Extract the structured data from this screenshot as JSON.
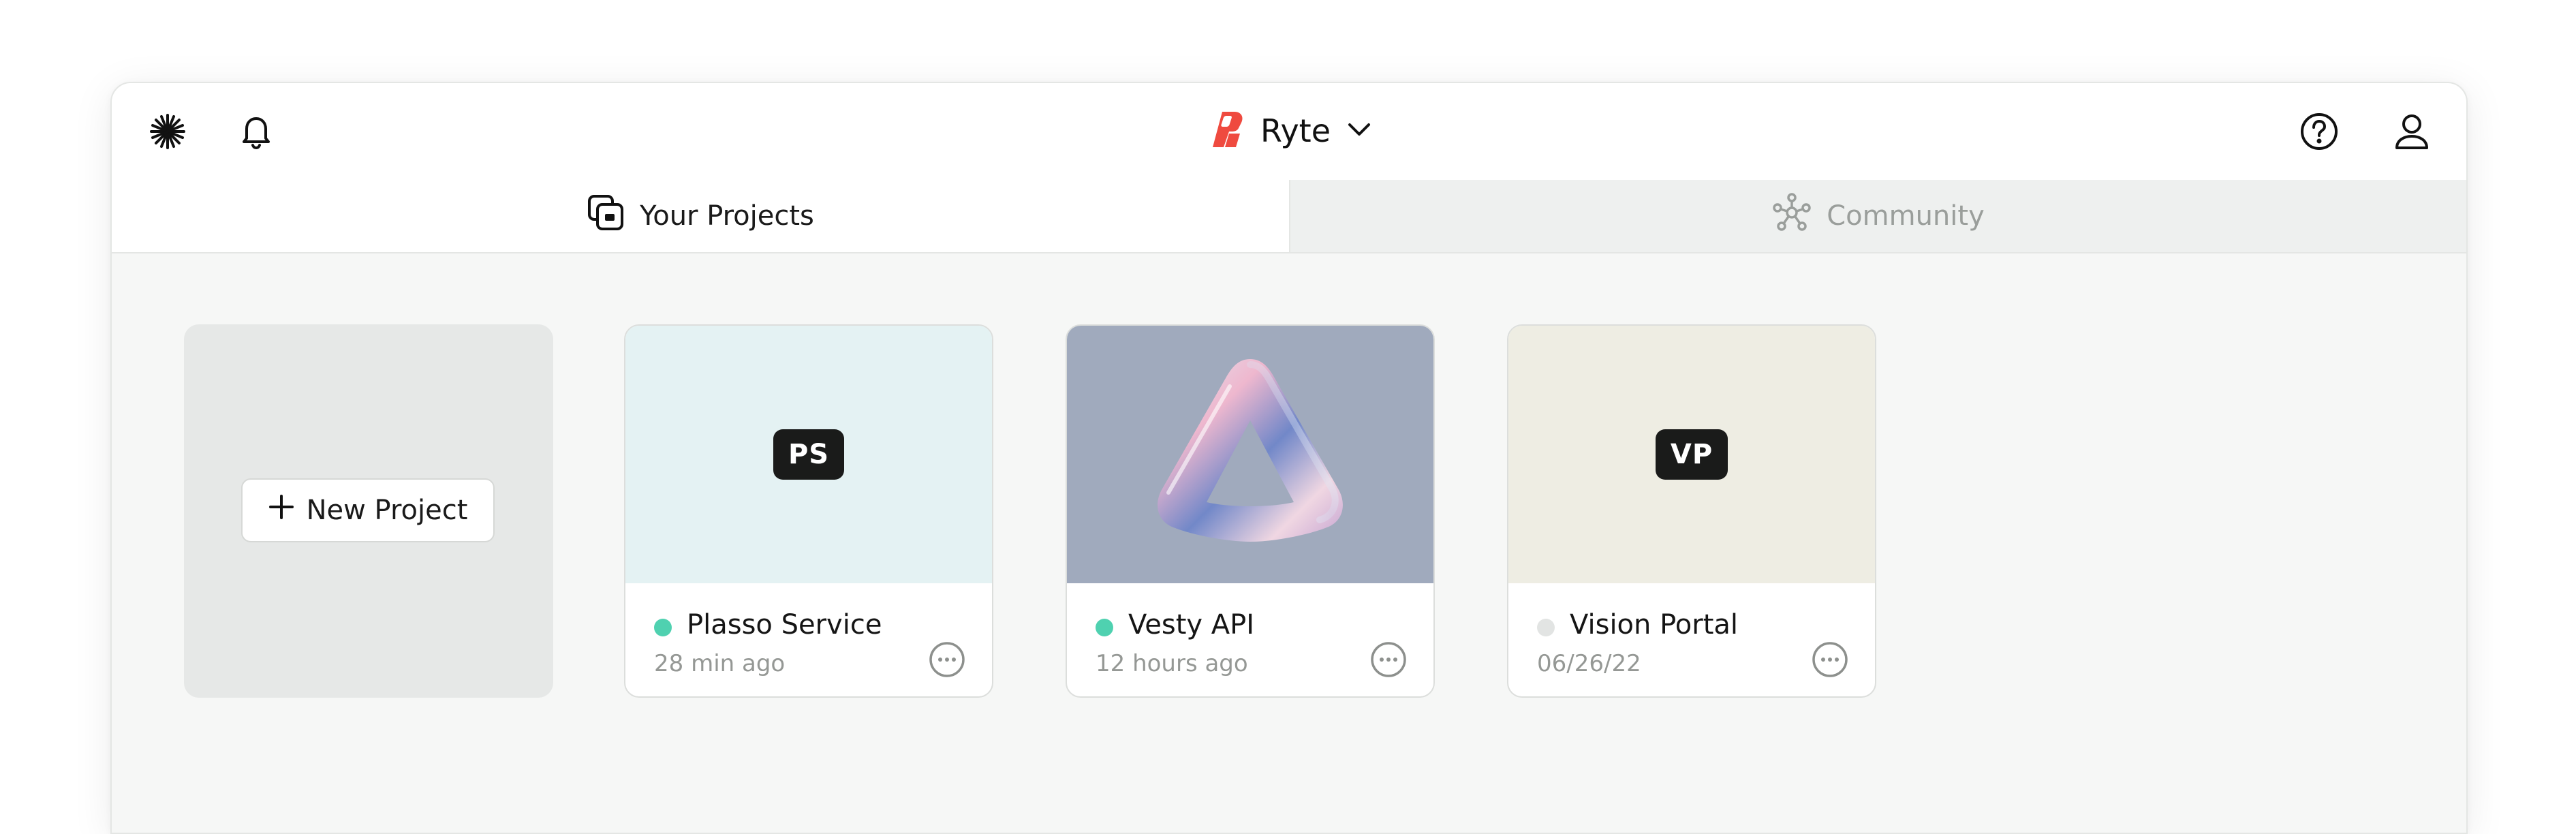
{
  "header": {
    "brand_name": "Ryte",
    "icons": [
      "sparkle-icon",
      "bell-icon",
      "ryte-logo-icon",
      "chevron-down-icon",
      "help-icon",
      "user-icon"
    ]
  },
  "tabs": [
    {
      "label": "Your Projects",
      "active": true,
      "icon": "projects-icon"
    },
    {
      "label": "Community",
      "active": false,
      "icon": "community-icon"
    }
  ],
  "new_project": {
    "label": "New Project"
  },
  "projects": [
    {
      "name": "Plasso Service",
      "time": "28 min ago",
      "initials": "PS",
      "status": "active",
      "status_color": "#4fd1b0",
      "thumb_color": "#e4f2f3"
    },
    {
      "name": "Vesty API",
      "time": "12 hours ago",
      "initials": "",
      "status": "active",
      "status_color": "#4fd1b0",
      "thumb_color": "#a0aabd",
      "thumb_image": "glass-triangle"
    },
    {
      "name": "Vision Portal",
      "time": "06/26/22",
      "initials": "VP",
      "status": "inactive",
      "status_color": "#e2e4e3",
      "thumb_color": "#eeede3"
    }
  ],
  "colors": {
    "brand": "#ef4a3f",
    "status_active": "#4fd1b0",
    "status_inactive": "#e2e4e3",
    "text_primary": "#151515",
    "text_muted": "#959895"
  }
}
